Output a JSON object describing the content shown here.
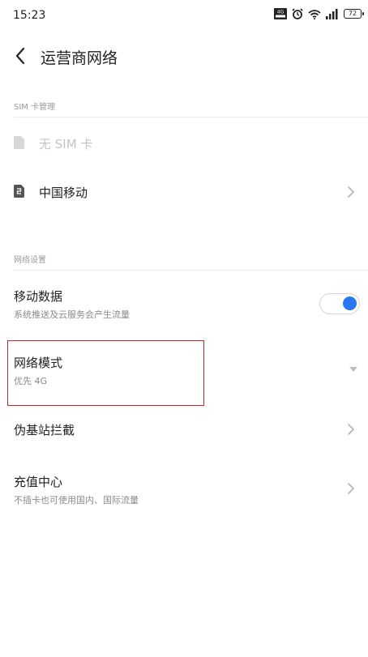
{
  "status_bar": {
    "time": "15:23",
    "network_badge": "4G",
    "battery": "72",
    "icons": [
      "network-icon",
      "alarm-icon",
      "wifi-icon",
      "signal-icon",
      "battery-icon"
    ]
  },
  "header": {
    "title": "运营商网络",
    "back_icon": "chevron-left-icon"
  },
  "sim_section": {
    "title": "SIM 卡管理",
    "items": [
      {
        "label": "无 SIM 卡",
        "enabled": false
      },
      {
        "label": "中国移动",
        "enabled": true
      }
    ]
  },
  "network_section": {
    "title": "网络设置",
    "mobile_data": {
      "title": "移动数据",
      "subtitle": "系统推送及云服务会产生流量",
      "enabled": true
    },
    "network_mode": {
      "title": "网络模式",
      "subtitle": "优先 4G"
    },
    "fake_base_station": {
      "title": "伪基站拦截"
    },
    "recharge": {
      "title": "充值中心",
      "subtitle": "不插卡也可使用国内、国际流量"
    }
  },
  "colors": {
    "accent": "#2879f0",
    "highlight_border": "#c0262b"
  }
}
